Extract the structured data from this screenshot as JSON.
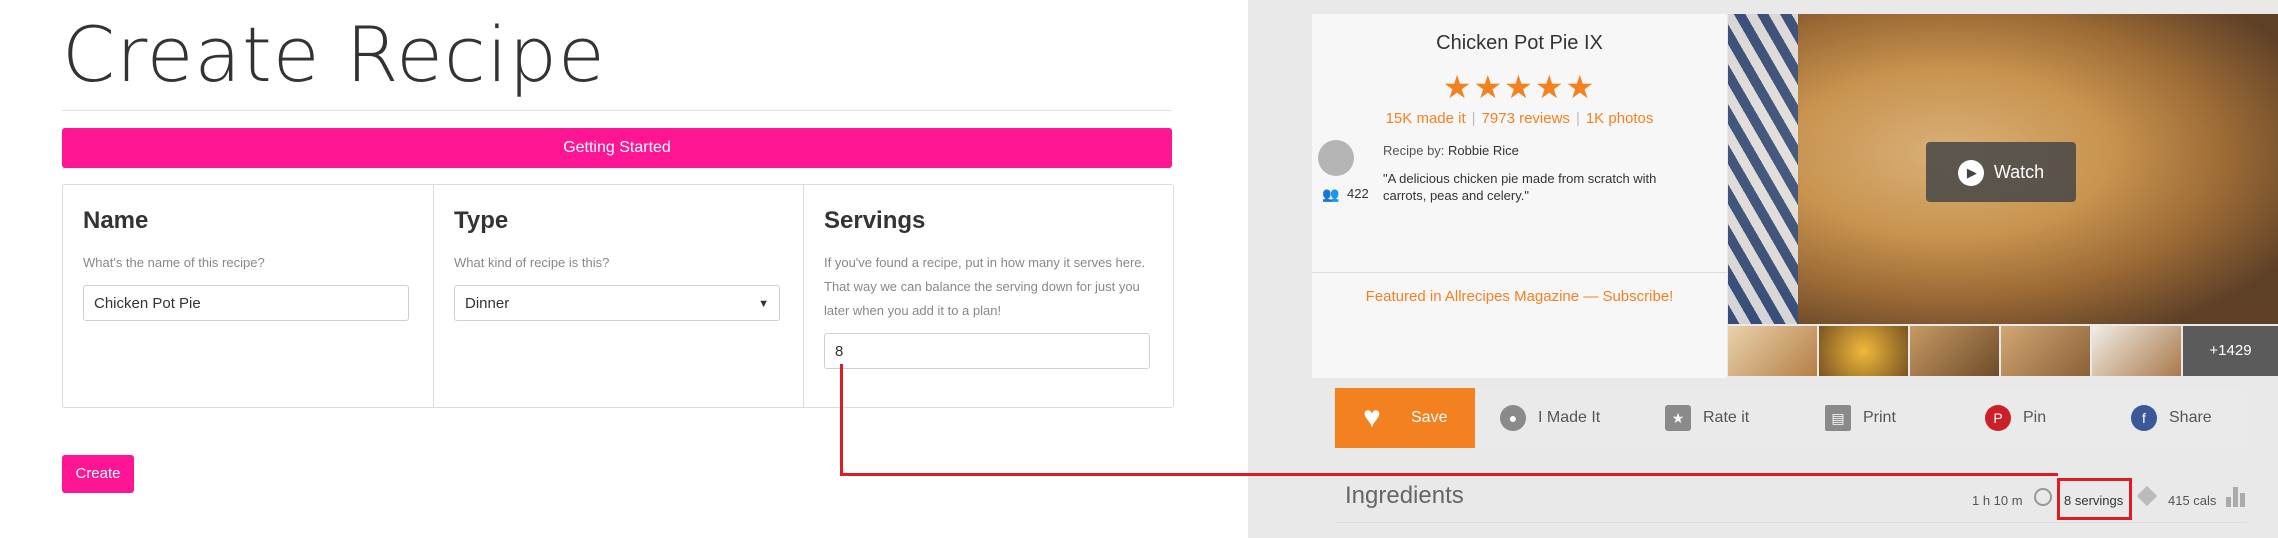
{
  "form": {
    "title": "Create Recipe",
    "banner": "Getting Started",
    "name": {
      "heading": "Name",
      "help": "What's the name of this recipe?",
      "value": "Chicken Pot Pie"
    },
    "type": {
      "heading": "Type",
      "help": "What kind of recipe is this?",
      "value": "Dinner"
    },
    "servings": {
      "heading": "Servings",
      "help": "If you've found a recipe, put in how many it serves here. That way we can balance the serving down for just you later when you add it to a plan!",
      "value": "8"
    },
    "create_label": "Create"
  },
  "recipe": {
    "title": "Chicken Pot Pie IX",
    "stars": "★★★★★",
    "rating": 5,
    "made_it": "15K made it",
    "reviews": "7973 reviews",
    "photos": "1K photos",
    "recipe_by_label": "Recipe by:",
    "author": "Robbie Rice",
    "followers": "422",
    "description": "\"A delicious chicken pie made from scratch with carrots, peas and celery.\"",
    "featured": "Featured in Allrecipes Magazine — Subscribe!",
    "watch_label": "Watch",
    "more_photos": "+1429",
    "actions": {
      "save": "Save",
      "made_it": "I Made It",
      "rate": "Rate it",
      "print": "Print",
      "pin": "Pin",
      "share": "Share"
    },
    "ingredients_heading": "Ingredients",
    "time": "1 h 10 m",
    "servings": "8 servings",
    "cals": "415 cals"
  },
  "colors": {
    "brand_pink": "#ff1493",
    "allrecipes_orange": "#f48120",
    "highlight_red": "#e11b22"
  },
  "icons": [
    "heart-icon",
    "made-it-icon",
    "rate-icon",
    "print-icon",
    "pinterest-icon",
    "facebook-icon",
    "play-icon",
    "clock-icon",
    "cube-icon",
    "nutrition-bars-icon",
    "followers-icon"
  ]
}
